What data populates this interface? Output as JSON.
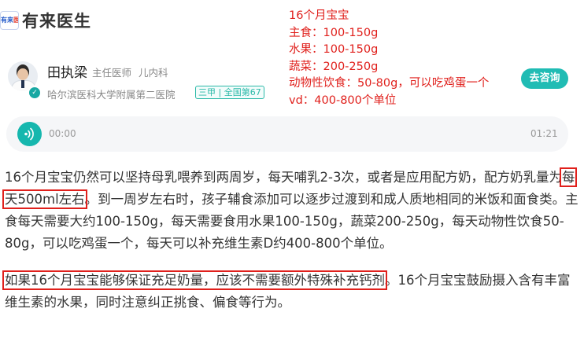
{
  "header": {
    "logo_text_a": "有来",
    "logo_text_b": "医",
    "app_title": "有来医生"
  },
  "annotation": {
    "lines": [
      "16个月宝宝",
      "主食：100-150g",
      "水果：100-150g",
      "蔬菜：200-250g",
      "动物性饮食：50-80g，可以吃鸡蛋一个",
      "vd：400-800个单位"
    ],
    "color": "#e0201c"
  },
  "doctor": {
    "name": "田执梁",
    "title": "主任医师",
    "department": "儿内科",
    "hospital": "哈尔滨医科大学附属第二医院",
    "badge": "三甲 | 全国第67",
    "consult_label": "去咨询",
    "verified_icon": "check-icon"
  },
  "audio": {
    "current_time": "00:00",
    "duration": "01:21",
    "accent": "#16b7ae"
  },
  "answer": {
    "p1_before": "16个月宝宝仍然可以坚持母乳喂养到两周岁，每天哺乳2-3次，或者是应用配方奶，配方奶乳量为",
    "p1_highlight": "每天500ml左右",
    "p1_after": "。到一周岁左右时，孩子辅食添加可以逐步过渡到和成人质地相同的米饭和面食类。主食每天需要大约100-150g，每天需要食用水果100-150g，蔬菜200-250g，每天动物性饮食50-80g，可以吃鸡蛋一个，每天可以补充维生素D约400-800个单位。",
    "p2_highlight": "如果16个月宝宝能够保证充足奶量，应该不需要额外特殊补充钙剂",
    "p2_after": "。16个月宝宝鼓励摄入含有丰富维生素的水果，同时注意纠正挑食、偏食等行为。",
    "highlight_color": "#e0201c"
  }
}
